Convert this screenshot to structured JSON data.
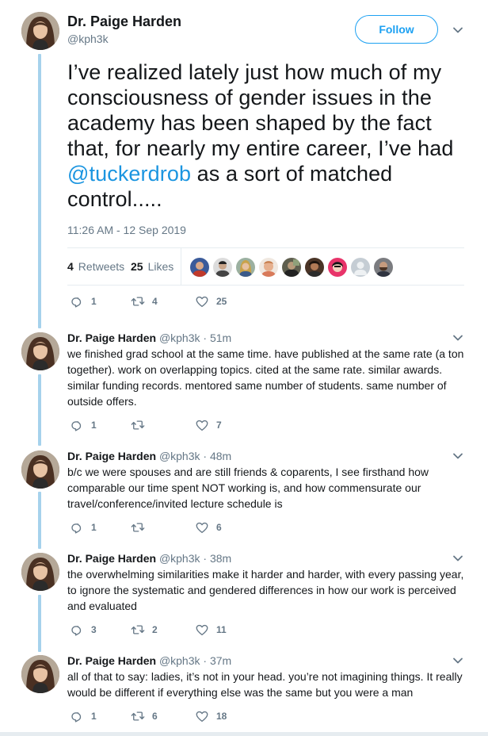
{
  "author": {
    "name": "Dr. Paige Harden",
    "handle": "@kph3k"
  },
  "follow_label": "Follow",
  "main_tweet": {
    "text_before": "I’ve realized lately just how much of my consciousness of gender issues in the academy has been shaped by the fact that, for nearly my entire career, I’ve had ",
    "mention": "@tuckerdrob",
    "text_after": " as a sort of matched control.....",
    "timestamp": "11:26 AM - 12 Sep 2019",
    "retweets_count": "4",
    "retweets_label": "Retweets",
    "likes_count": "25",
    "likes_label": "Likes",
    "actions": {
      "replies": "1",
      "retweets": "4",
      "likes": "25"
    }
  },
  "replies": [
    {
      "name": "Dr. Paige Harden",
      "handle": "@kph3k",
      "time": "· 51m",
      "text": "we finished grad school at the same time. have published at the same rate (a ton together). work on overlapping topics. cited at the same rate. similar awards. similar funding records. mentored same number of students. same number of outside offers.",
      "replies": "1",
      "retweets": "",
      "likes": "7"
    },
    {
      "name": "Dr. Paige Harden",
      "handle": "@kph3k",
      "time": "· 48m",
      "text": "b/c we were spouses and are still friends & coparents, I see firsthand how comparable our time spent NOT working is, and how commensurate our travel/conference/invited lecture schedule is",
      "replies": "1",
      "retweets": "",
      "likes": "6"
    },
    {
      "name": "Dr. Paige Harden",
      "handle": "@kph3k",
      "time": "· 38m",
      "text": "the overwhelming similarities make it harder and harder, with every passing year, to ignore the systematic and gendered differences in how our work is perceived and evaluated",
      "replies": "3",
      "retweets": "2",
      "likes": "11"
    },
    {
      "name": "Dr. Paige Harden",
      "handle": "@kph3k",
      "time": "· 37m",
      "text": "all of that to say: ladies, it’s not in your head. you’re not imagining things. It really would be different if everything else was the same but you were a man",
      "replies": "1",
      "retweets": "6",
      "likes": "18"
    }
  ],
  "colors": {
    "accent": "#1da1f2",
    "mention": "#1b95e0",
    "thread_line": "#a6d2ec",
    "muted": "#657786"
  },
  "icons": [
    "avatar-photo",
    "chevron-down-icon",
    "reply-icon",
    "retweet-icon",
    "heart-icon"
  ]
}
